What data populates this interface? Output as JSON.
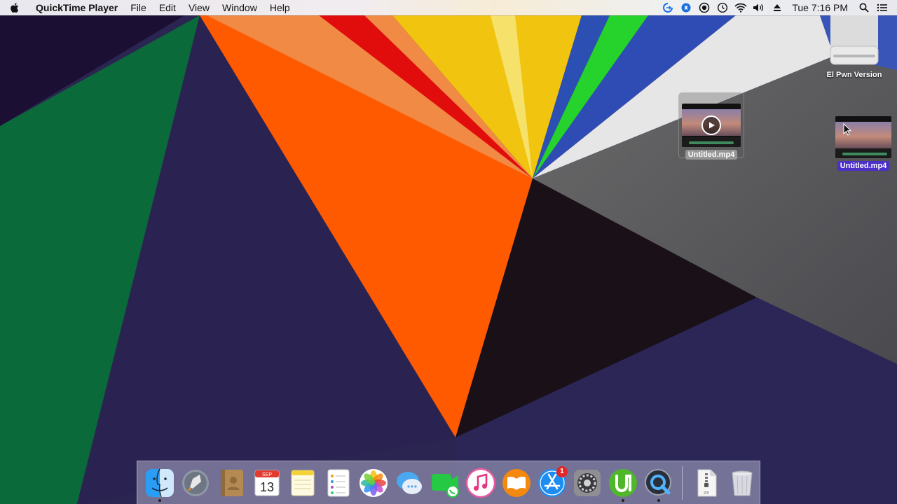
{
  "menubar": {
    "apple_icon": "apple-icon",
    "app_name": "QuickTime Player",
    "menus": [
      "File",
      "Edit",
      "View",
      "Window",
      "Help"
    ],
    "status_icons": [
      "teamviewer-icon",
      "shazam-icon",
      "record-icon",
      "time-machine-icon",
      "wifi-icon",
      "volume-icon",
      "eject-icon"
    ],
    "clock": "Tue 7:16 PM",
    "spotlight_icon": "spotlight-search-icon",
    "notification_icon": "notification-center-icon"
  },
  "desktop": {
    "drive": {
      "label": "El Pwn Version",
      "icon": "external-drive-icon"
    },
    "dragged_file": {
      "label": "Untitled.mp4",
      "icon": "video-thumbnail-icon"
    },
    "selected_file": {
      "label": "Untitled.mp4",
      "icon": "video-thumbnail-icon"
    }
  },
  "dock": {
    "apps": [
      {
        "name": "Finder",
        "icon": "finder-icon",
        "running": true
      },
      {
        "name": "Launchpad",
        "icon": "launchpad-icon",
        "running": false
      },
      {
        "name": "Contacts",
        "icon": "contacts-icon",
        "running": false
      },
      {
        "name": "Calendar",
        "icon": "calendar-icon",
        "running": false,
        "month": "SEP",
        "day": "13"
      },
      {
        "name": "Notes",
        "icon": "notes-icon",
        "running": false
      },
      {
        "name": "Reminders",
        "icon": "reminders-icon",
        "running": false
      },
      {
        "name": "Photos",
        "icon": "photos-icon",
        "running": false
      },
      {
        "name": "Messages",
        "icon": "messages-icon",
        "running": false
      },
      {
        "name": "FaceTime",
        "icon": "facetime-icon",
        "running": false
      },
      {
        "name": "iTunes",
        "icon": "itunes-icon",
        "running": false
      },
      {
        "name": "iBooks",
        "icon": "ibooks-icon",
        "running": false
      },
      {
        "name": "App Store",
        "icon": "app-store-icon",
        "running": false,
        "badge": "1"
      },
      {
        "name": "System Preferences",
        "icon": "system-preferences-icon",
        "running": false
      },
      {
        "name": "uTorrent",
        "icon": "utorrent-icon",
        "running": true
      },
      {
        "name": "QuickTime Player",
        "icon": "quicktime-icon",
        "running": true
      }
    ],
    "others": [
      {
        "name": "Archive",
        "icon": "zip-file-icon",
        "label": "ZIP"
      },
      {
        "name": "Trash",
        "icon": "trash-icon"
      }
    ]
  },
  "colors": {
    "selection": "#4b2fc7",
    "wallpaper_navy": "#2a2450",
    "wallpaper_orange": "#ff5a00",
    "wallpaper_green": "#0a6b3a"
  }
}
